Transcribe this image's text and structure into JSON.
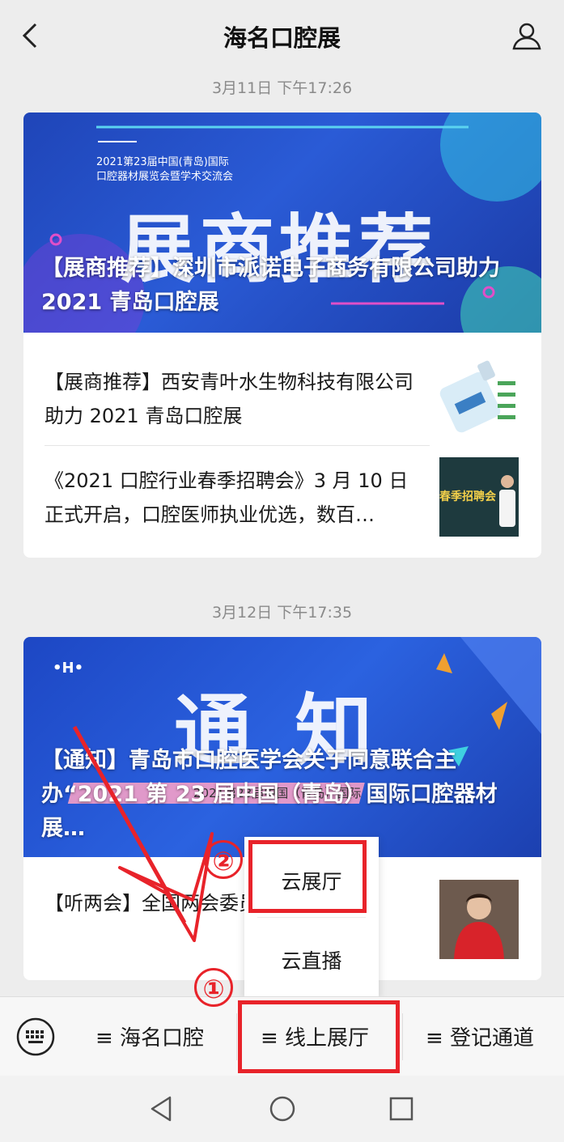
{
  "header": {
    "title": "海名口腔展"
  },
  "messages": [
    {
      "timestamp": "3月11日 下午17:26",
      "hero_caption": "【展商推荐】深圳市派诺电子商务有限公司助力 2021 青岛口腔展",
      "hero_big": "展商推荐",
      "hero_sub": "2021第23届中国(青岛)国际",
      "hero_sub2": "口腔器材展览会暨学术交流会",
      "items": [
        {
          "text": "【展商推荐】西安青叶水生物科技有限公司助力 2021 青岛口腔展"
        },
        {
          "text": "《2021 口腔行业春季招聘会》3 月 10 日正式开启，口腔医师执业优选，数百…",
          "thumb_text": "春季招聘会"
        }
      ]
    },
    {
      "timestamp": "3月12日 下午17:35",
      "hero_caption": "【通知】青岛市口腔医学会关于同意联合主办“2021 第 23 届中国（青岛）国际口腔器材展…",
      "hero_big": "通 知",
      "hero_sub": "2021第23届中国（青岛）国际",
      "items": [
        {
          "text": "【听两会】全国两会委员关注口腔健康"
        }
      ]
    }
  ],
  "popup_menu": {
    "items": [
      "云展厅",
      "云直播"
    ]
  },
  "bottom_menu": {
    "items": [
      "≡ 海名口腔",
      "≡ 线上展厅",
      "≡ 登记通道"
    ]
  },
  "annotations": {
    "step1": "①",
    "step2": "②",
    "highlight_color": "#e8232a"
  }
}
